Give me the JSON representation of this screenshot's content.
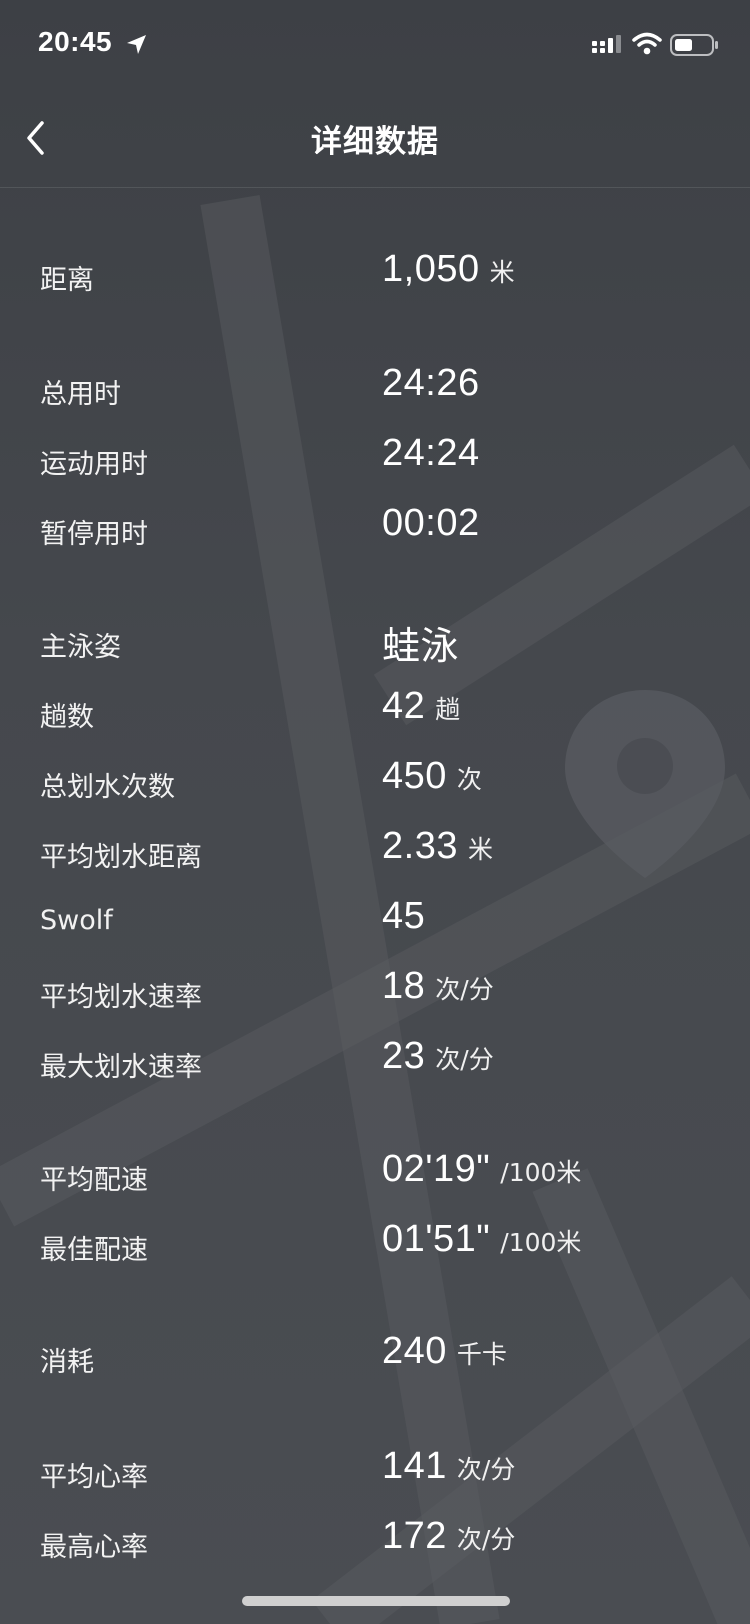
{
  "status_bar": {
    "time": "20:45"
  },
  "nav": {
    "title": "详细数据"
  },
  "rows": [
    {
      "label": "距离",
      "value": "1,050",
      "unit": "米"
    },
    {
      "label": "总用时",
      "value": "24:26",
      "unit": ""
    },
    {
      "label": "运动用时",
      "value": "24:24",
      "unit": ""
    },
    {
      "label": "暂停用时",
      "value": "00:02",
      "unit": ""
    },
    {
      "label": "主泳姿",
      "value": "蛙泳",
      "unit": ""
    },
    {
      "label": "趟数",
      "value": "42",
      "unit": "趟"
    },
    {
      "label": "总划水次数",
      "value": "450",
      "unit": "次"
    },
    {
      "label": "平均划水距离",
      "value": "2.33",
      "unit": "米"
    },
    {
      "label": "Swolf",
      "value": "45",
      "unit": ""
    },
    {
      "label": "平均划水速率",
      "value": "18",
      "unit": "次/分"
    },
    {
      "label": "最大划水速率",
      "value": "23",
      "unit": "次/分"
    },
    {
      "label": "平均配速",
      "value": "02'19\"",
      "unit": "/100米"
    },
    {
      "label": "最佳配速",
      "value": "01'51\"",
      "unit": "/100米"
    },
    {
      "label": "消耗",
      "value": "240",
      "unit": "千卡"
    },
    {
      "label": "平均心率",
      "value": "141",
      "unit": "次/分"
    },
    {
      "label": "最高心率",
      "value": "172",
      "unit": "次/分"
    }
  ]
}
